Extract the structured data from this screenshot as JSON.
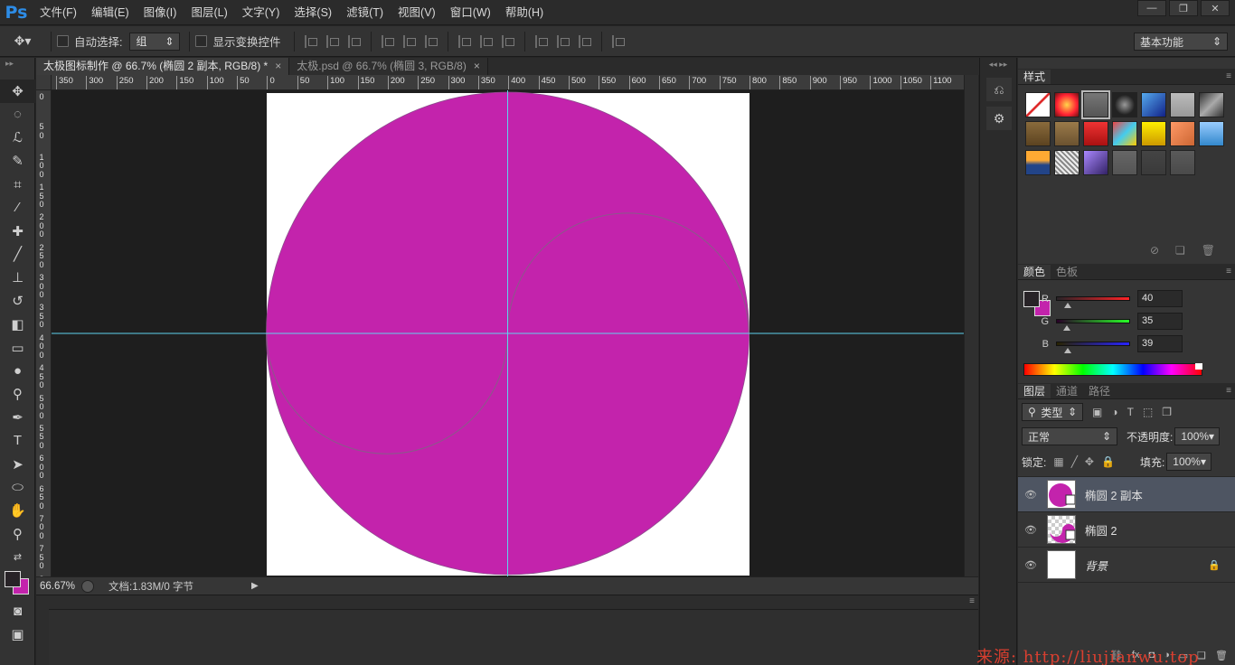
{
  "app": {
    "logo": "Ps"
  },
  "menu": [
    "文件(F)",
    "编辑(E)",
    "图像(I)",
    "图层(L)",
    "文字(Y)",
    "选择(S)",
    "滤镜(T)",
    "视图(V)",
    "窗口(W)",
    "帮助(H)"
  ],
  "window_controls": [
    "—",
    "❐",
    "✕"
  ],
  "options": {
    "auto_select_label": "自动选择:",
    "auto_select_value": "组",
    "show_transform_label": "显示变换控件",
    "workspace": "基本功能"
  },
  "tabs": [
    {
      "title": "太极图标制作 @ 66.7% (椭圆 2 副本, RGB/8) *",
      "close": "×"
    },
    {
      "title": "太极.psd @ 66.7% (椭圆 3, RGB/8)",
      "close": "×"
    }
  ],
  "ruler_h": [
    "350",
    "300",
    "250",
    "200",
    "150",
    "100",
    "50",
    "0",
    "50",
    "100",
    "150",
    "200",
    "250",
    "300",
    "350",
    "400",
    "450",
    "500",
    "550",
    "600",
    "650",
    "700",
    "750",
    "800",
    "850",
    "900",
    "950",
    "1000",
    "1050",
    "1100"
  ],
  "ruler_v": [
    "0",
    "50",
    "100",
    "150",
    "200",
    "250",
    "300",
    "350",
    "400",
    "450",
    "500",
    "550",
    "600",
    "650",
    "700",
    "750",
    "800"
  ],
  "status": {
    "zoom": "66.67%",
    "doc": "文档:1.83M/0 字节",
    "arrow": "▶"
  },
  "colors": {
    "fill": "#c323ac",
    "guide": "#5fd3ee",
    "canvas": "#ffffff"
  },
  "styles_panel": {
    "tab": "样式"
  },
  "color_panel": {
    "tabs": [
      "颜色",
      "色板"
    ],
    "channels": [
      {
        "label": "R",
        "value": "40"
      },
      {
        "label": "G",
        "value": "35"
      },
      {
        "label": "B",
        "value": "39"
      }
    ]
  },
  "layers_panel": {
    "tabs": [
      "图层",
      "通道",
      "路径"
    ],
    "filter": "类型",
    "blend_mode": "正常",
    "opacity_label": "不透明度:",
    "opacity": "100%",
    "lock_label": "锁定:",
    "fill_label": "填充:",
    "fill": "100%",
    "layers": [
      {
        "name": "椭圆 2 副本",
        "selected": true
      },
      {
        "name": "椭圆 2",
        "selected": false
      },
      {
        "name": "背景",
        "selected": false
      }
    ]
  },
  "watermark": "来源: http://liujianwu.top"
}
